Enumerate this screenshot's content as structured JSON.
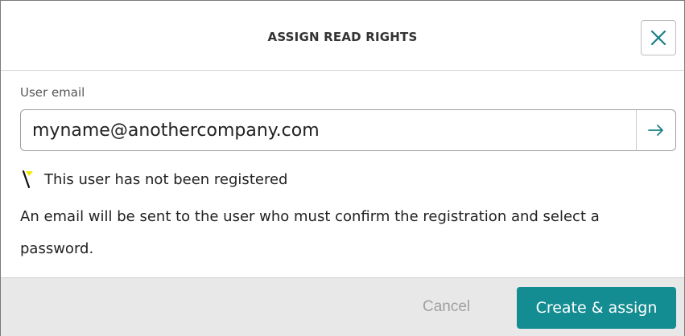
{
  "dialog": {
    "title": "ASSIGN READ RIGHTS",
    "close_icon": "close-icon"
  },
  "form": {
    "email_label": "User email",
    "email_value": "myname@anothercompany.com",
    "submit_icon": "arrow-right-icon"
  },
  "status": {
    "warning_icon": "flag-icon",
    "warning_text": "This user has not been registered",
    "info_text": "An email will be sent to the user who must confirm the registration and select a password."
  },
  "footer": {
    "cancel_label": "Cancel",
    "primary_label": "Create & assign"
  },
  "colors": {
    "accent": "#138c92",
    "close_icon": "#1a7f86",
    "flag_yellow": "#f2e600",
    "footer_bg": "#e8e8e8",
    "muted_text": "#a0a0a0"
  }
}
